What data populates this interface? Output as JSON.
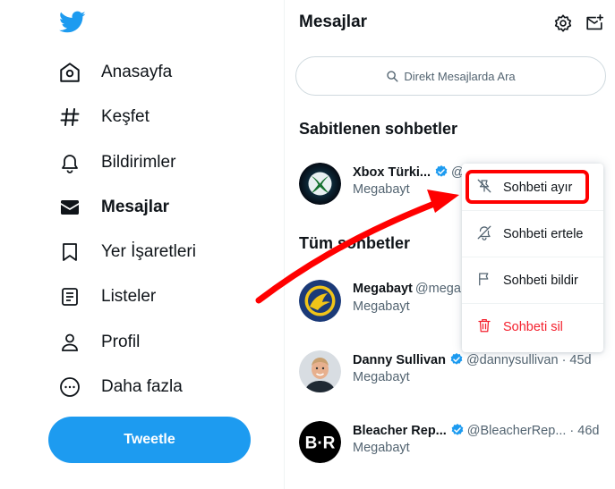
{
  "sidebar": {
    "logo_icon": "twitter-bird-icon",
    "items": [
      {
        "label": "Anasayfa",
        "icon": "home-icon"
      },
      {
        "label": "Keşfet",
        "icon": "hashtag-icon"
      },
      {
        "label": "Bildirimler",
        "icon": "bell-icon"
      },
      {
        "label": "Mesajlar",
        "icon": "envelope-icon",
        "active": true
      },
      {
        "label": "Yer İşaretleri",
        "icon": "bookmark-icon"
      },
      {
        "label": "Listeler",
        "icon": "list-icon"
      },
      {
        "label": "Profil",
        "icon": "person-icon"
      },
      {
        "label": "Daha fazla",
        "icon": "more-circle-icon"
      }
    ],
    "tweet_button": "Tweetle"
  },
  "messages": {
    "title": "Mesajlar",
    "settings_icon": "gear-icon",
    "new_message_icon": "compose-message-icon",
    "search_placeholder": "Direkt Mesajlarda Ara",
    "pinned_title": "Sabitlenen sohbetler",
    "all_title": "Tüm sohbetler",
    "pinned": [
      {
        "name": "Xbox Türki...",
        "handle": "@",
        "preview": "Megabayt",
        "verified": true
      }
    ],
    "all": [
      {
        "name": "Megabayt",
        "handle": "@mega",
        "time": "",
        "preview": "Megabayt",
        "verified": false
      },
      {
        "name": "Danny Sullivan",
        "handle": "@dannysullivan · 45d",
        "preview": "Megabayt",
        "verified": true
      },
      {
        "name": "Bleacher Rep...",
        "handle": "@BleacherRep... · 46d",
        "preview": "Megabayt",
        "verified": true
      }
    ]
  },
  "context_menu": {
    "items": [
      {
        "label": "Sohbeti ayır",
        "icon": "unpin-icon"
      },
      {
        "label": "Sohbeti ertele",
        "icon": "snooze-bell-icon"
      },
      {
        "label": "Sohbeti bildir",
        "icon": "flag-icon"
      },
      {
        "label": "Sohbeti sil",
        "icon": "trash-icon",
        "danger": true
      }
    ]
  },
  "colors": {
    "brand": "#1d9bf0",
    "danger": "#f4212e",
    "annotation": "#ff0000"
  }
}
